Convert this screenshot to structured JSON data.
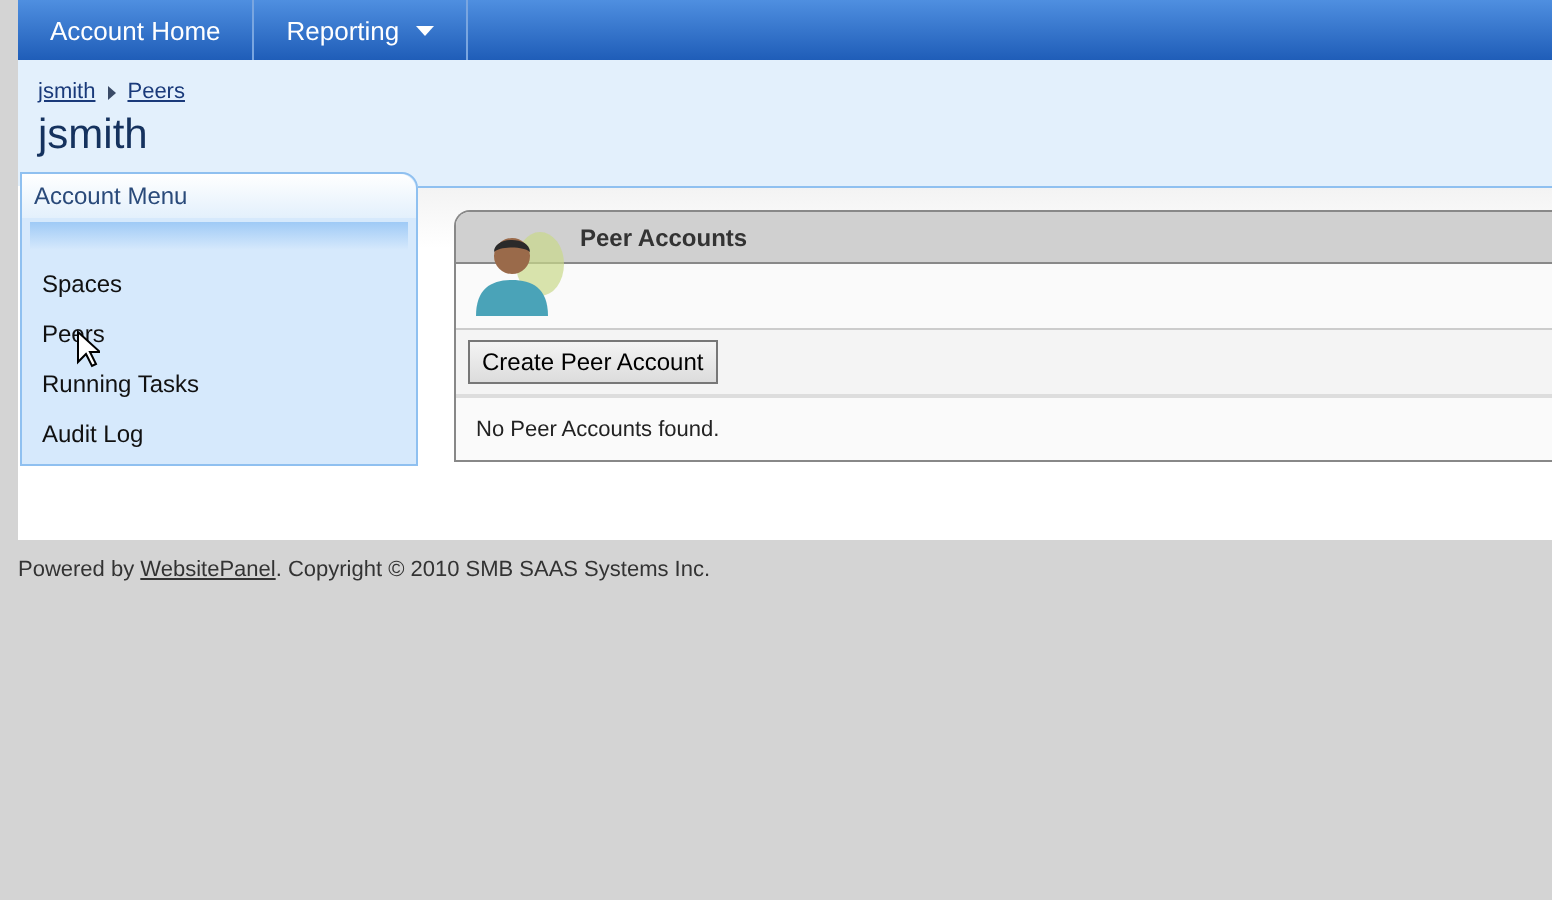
{
  "nav": [
    {
      "label": "Account Home",
      "has_dropdown": false
    },
    {
      "label": "Reporting",
      "has_dropdown": true
    }
  ],
  "breadcrumb": [
    "jsmith",
    "Peers"
  ],
  "page_title": "jsmith",
  "account_menu": {
    "title": "Account Menu",
    "items": [
      "Spaces",
      "Peers",
      "Running Tasks",
      "Audit Log"
    ]
  },
  "panel": {
    "title": "Peer Accounts",
    "button": "Create Peer Account",
    "message": "No Peer Accounts found."
  },
  "footer": {
    "before": "Powered by",
    "link": "WebsitePanel",
    "after": ". Copyright © 2010 SMB SAAS Systems Inc."
  }
}
